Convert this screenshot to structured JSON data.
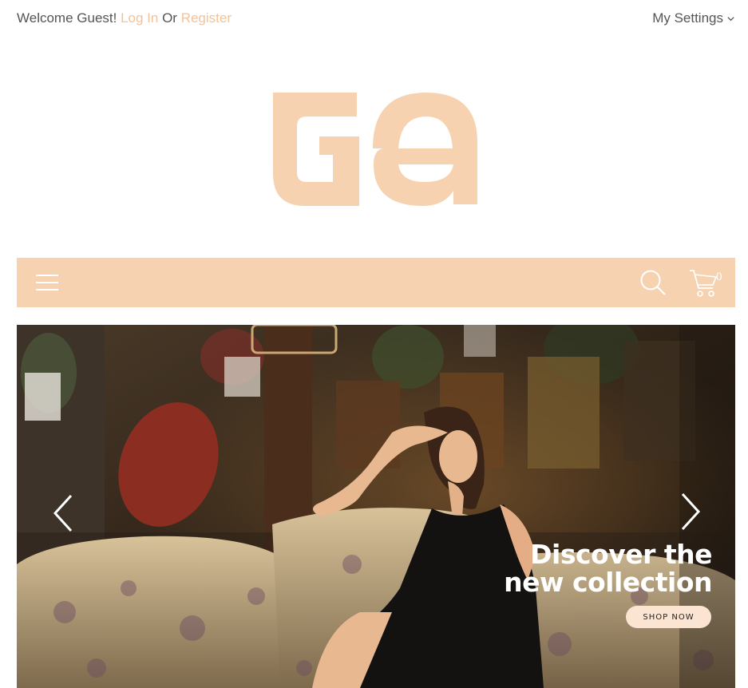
{
  "header": {
    "welcome_text": "Welcome Guest!",
    "login_label": "Log In",
    "or_text": "Or",
    "register_label": "Register",
    "settings_label": "My Settings"
  },
  "logo": {
    "icon": "ga-logo"
  },
  "navbar": {
    "menu_icon": "hamburger-icon",
    "search_icon": "search-icon",
    "cart_icon": "cart-icon",
    "cart_count": "0"
  },
  "hero": {
    "headline_line1": "Discover the",
    "headline_line2": "new collection",
    "cta_label": "SHOP NOW",
    "prev_icon": "chevron-left-icon",
    "next_icon": "chevron-right-icon"
  },
  "colors": {
    "accent": "#f7d2b0",
    "link": "#f2c29a",
    "cta_bg": "#fbe4d2",
    "text": "#555555"
  }
}
